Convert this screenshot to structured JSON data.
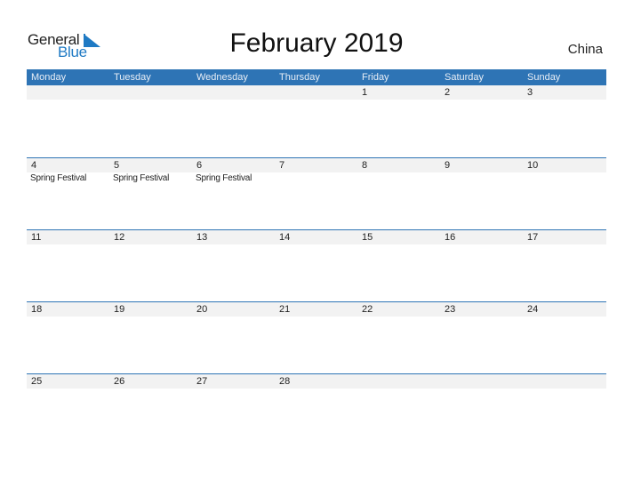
{
  "logo": {
    "word1": "General",
    "word2": "Blue"
  },
  "title": "February 2019",
  "country": "China",
  "colors": {
    "accent": "#2e74b5",
    "band": "#f2f2f2",
    "logo_blue": "#1f7ac4"
  },
  "weekdays": [
    "Monday",
    "Tuesday",
    "Wednesday",
    "Thursday",
    "Friday",
    "Saturday",
    "Sunday"
  ],
  "weeks": [
    [
      {
        "day": ""
      },
      {
        "day": ""
      },
      {
        "day": ""
      },
      {
        "day": ""
      },
      {
        "day": "1"
      },
      {
        "day": "2"
      },
      {
        "day": "3"
      }
    ],
    [
      {
        "day": "4",
        "event": "Spring Festival"
      },
      {
        "day": "5",
        "event": "Spring Festival"
      },
      {
        "day": "6",
        "event": "Spring Festival"
      },
      {
        "day": "7"
      },
      {
        "day": "8"
      },
      {
        "day": "9"
      },
      {
        "day": "10"
      }
    ],
    [
      {
        "day": "11"
      },
      {
        "day": "12"
      },
      {
        "day": "13"
      },
      {
        "day": "14"
      },
      {
        "day": "15"
      },
      {
        "day": "16"
      },
      {
        "day": "17"
      }
    ],
    [
      {
        "day": "18"
      },
      {
        "day": "19"
      },
      {
        "day": "20"
      },
      {
        "day": "21"
      },
      {
        "day": "22"
      },
      {
        "day": "23"
      },
      {
        "day": "24"
      }
    ],
    [
      {
        "day": "25"
      },
      {
        "day": "26"
      },
      {
        "day": "27"
      },
      {
        "day": "28"
      },
      {
        "day": ""
      },
      {
        "day": ""
      },
      {
        "day": ""
      }
    ]
  ]
}
